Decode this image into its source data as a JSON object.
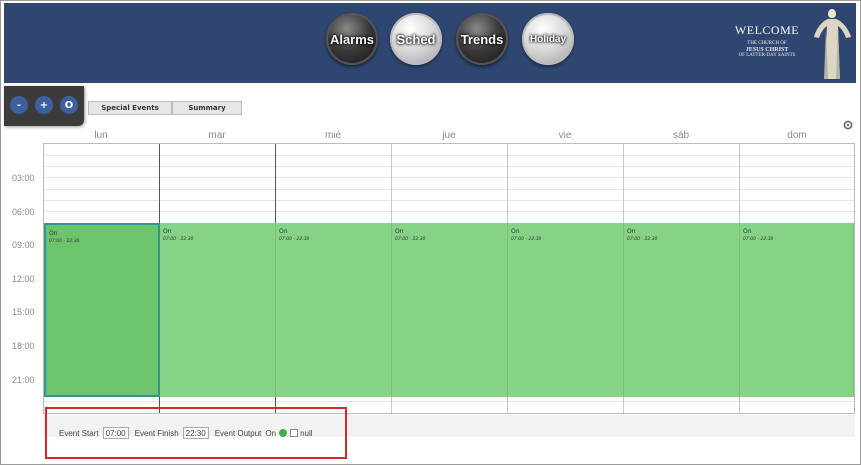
{
  "header": {
    "nav": [
      {
        "label": "Alarms",
        "style": "dark"
      },
      {
        "label": "Sched",
        "style": "light"
      },
      {
        "label": "Trends",
        "style": "dark"
      },
      {
        "label": "Holiday",
        "style": "light"
      }
    ],
    "welcome": "WELCOME",
    "logo_line1": "THE CHURCH OF",
    "logo_line2": "JESUS CHRIST",
    "logo_line3": "OF LATTER-DAY SAINTS",
    "bg_color": "#2f4670"
  },
  "zoom": {
    "minus": "-",
    "plus": "+",
    "reset": "O"
  },
  "tabs": [
    {
      "label": "Special Events"
    },
    {
      "label": "Summary"
    }
  ],
  "days": [
    "lun",
    "mar",
    "mié",
    "jue",
    "vie",
    "sáb",
    "dom"
  ],
  "times": [
    "03:00",
    "06:00",
    "09:00",
    "12:00",
    "15:00",
    "18:00",
    "21:00"
  ],
  "events": [
    {
      "day": "lun",
      "title": "On",
      "time": "07:00 - 22:30",
      "selected": true
    },
    {
      "day": "mar",
      "title": "On",
      "time": "07:00 - 22:30",
      "selected": false
    },
    {
      "day": "mié",
      "title": "On",
      "time": "07:00 - 22:30",
      "selected": false
    },
    {
      "day": "jue",
      "title": "On",
      "time": "07:00 - 22:30",
      "selected": false
    },
    {
      "day": "vie",
      "title": "On",
      "time": "07:00 - 22:30",
      "selected": false
    },
    {
      "day": "sáb",
      "title": "On",
      "time": "07:00 - 22:30",
      "selected": false
    },
    {
      "day": "dom",
      "title": "On",
      "time": "07:00 - 22:30",
      "selected": false
    }
  ],
  "event_form": {
    "start_label": "Event Start",
    "start_hour": "07",
    "start_min": "00",
    "finish_label": "Event Finish",
    "finish_hour": "22",
    "finish_min": "30",
    "output_label": "Event Output",
    "output_on": "On",
    "output_null": "null",
    "separator": ":"
  },
  "colors": {
    "event": "#86d286",
    "selected_event": "#6cc46c",
    "highlight": "#d9262a",
    "on_dot": "#3fae4c"
  }
}
